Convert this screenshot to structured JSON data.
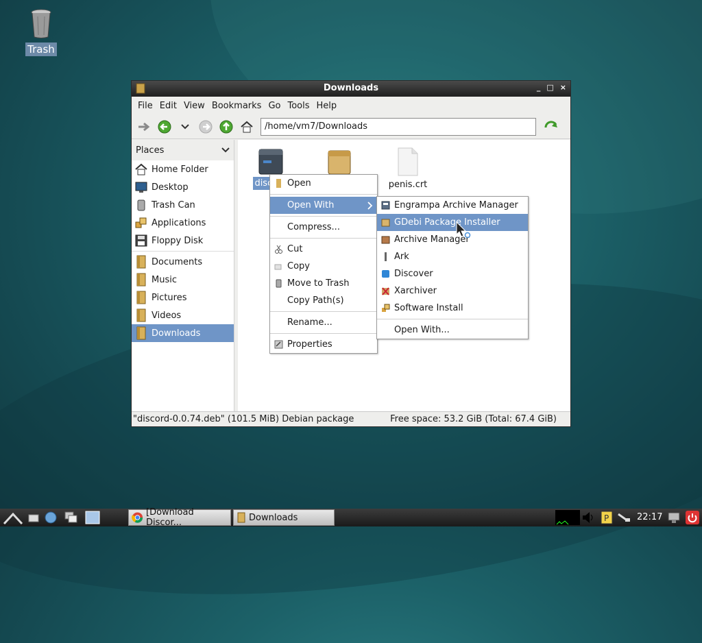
{
  "desktop": {
    "trash_label": "Trash"
  },
  "window": {
    "title": "Downloads",
    "controls": {
      "minimize": "_",
      "maximize": "□",
      "close": "×"
    }
  },
  "menubar": [
    "File",
    "Edit",
    "View",
    "Bookmarks",
    "Go",
    "Tools",
    "Help"
  ],
  "toolbar": {
    "path": "/home/vm7/Downloads"
  },
  "sidebar": {
    "header": "Places",
    "places": [
      {
        "label": "Home Folder",
        "icon": "home-icon"
      },
      {
        "label": "Desktop",
        "icon": "desktop-icon"
      },
      {
        "label": "Trash Can",
        "icon": "trash-icon"
      },
      {
        "label": "Applications",
        "icon": "applications-icon"
      },
      {
        "label": "Floppy Disk",
        "icon": "floppy-icon"
      }
    ],
    "bookmarks": [
      {
        "label": "Documents",
        "icon": "folder-icon"
      },
      {
        "label": "Music",
        "icon": "folder-icon"
      },
      {
        "label": "Pictures",
        "icon": "folder-icon"
      },
      {
        "label": "Videos",
        "icon": "folder-icon"
      },
      {
        "label": "Downloads",
        "icon": "folder-icon",
        "selected": true
      }
    ]
  },
  "files": [
    {
      "label": "discord",
      "icon": "deb-package-icon",
      "selected": true
    },
    {
      "label": "",
      "icon": "archive-box-icon"
    },
    {
      "label": "penis.crt",
      "icon": "document-icon"
    }
  ],
  "context_menu": {
    "items": [
      "Open",
      "Open With",
      "Compress...",
      "Cut",
      "Copy",
      "Move to Trash",
      "Copy Path(s)",
      "Rename...",
      "Properties"
    ]
  },
  "open_with_menu": {
    "items": [
      "Engrampa Archive Manager",
      "GDebi Package Installer",
      "Archive Manager",
      "Ark",
      "Discover",
      "Xarchiver",
      "Software Install",
      "Open With..."
    ],
    "highlighted": "GDebi Package Installer"
  },
  "statusbar": {
    "left": "\"discord-0.0.74.deb\" (101.5 MiB) Debian package",
    "right": "Free space: 53.2 GiB (Total: 67.4 GiB)"
  },
  "taskbar": {
    "tasks": [
      "[Download Discor...",
      "Downloads"
    ],
    "clock": "22:17"
  },
  "colors": {
    "selection": "#6f95c7",
    "titlebar": "#2a2a2a"
  }
}
